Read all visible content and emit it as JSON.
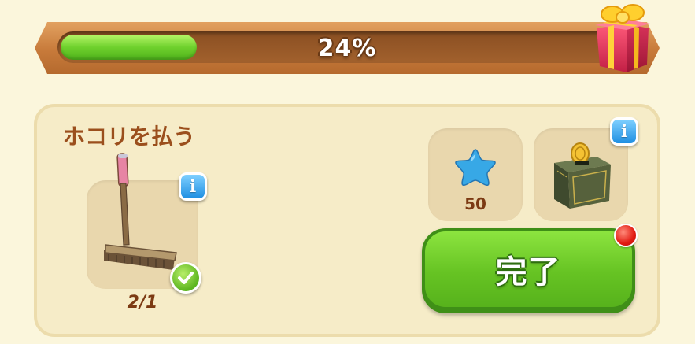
{
  "progress": {
    "label": "24%",
    "value": 0.24,
    "fill_color": "#6fd12d",
    "reward_icon": "gift-box-icon"
  },
  "task": {
    "title": "ホコリを払う",
    "tool_icon": "broom-icon",
    "tool_count": "2/1",
    "status_icon": "checkmark-icon",
    "info_icon": "info-icon"
  },
  "rewards": [
    {
      "icon": "blue-star-icon",
      "count": "50"
    },
    {
      "icon": "coin-safe-icon",
      "info_icon": "info-icon"
    }
  ],
  "complete_button": {
    "label": "完了",
    "color": "#66c323",
    "notification_icon": "red-dot-badge"
  }
}
